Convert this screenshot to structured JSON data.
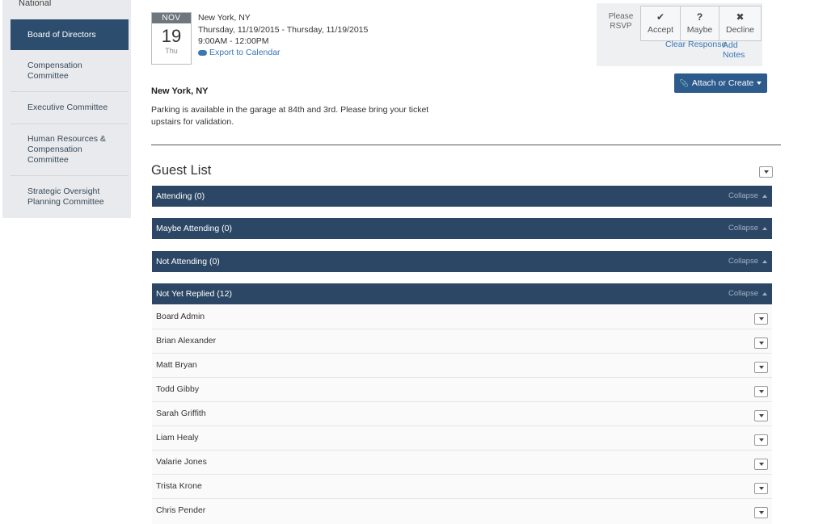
{
  "sidebar": {
    "top_label": "National",
    "items": [
      {
        "label": "Board of Directors",
        "active": true
      },
      {
        "label": "Compensation Committee",
        "active": false
      },
      {
        "label": "Executive Committee",
        "active": false
      },
      {
        "label": "Human Resources & Compensation Committee",
        "active": false
      },
      {
        "label": "Strategic Oversight Planning Committee",
        "active": false
      }
    ]
  },
  "event": {
    "month": "NOV",
    "day": "19",
    "weekday": "Thu",
    "location": "New York, NY",
    "date_range": "Thursday, 11/19/2015 - Thursday, 11/19/2015",
    "time_range": "9:00AM - 12:00PM",
    "export_label": "Export to Calendar",
    "location_title": "New York, NY",
    "location_description": "Parking is available in the garage at 84th and 3rd.  Please bring your ticket upstairs for validation."
  },
  "rsvp": {
    "label": "Please RSVP",
    "accept_label": "Accept",
    "maybe_label": "Maybe",
    "decline_label": "Decline",
    "accept_glyph": "✔",
    "maybe_glyph": "?",
    "decline_glyph": "✖",
    "clear_label": "Clear Response",
    "notes_label": "Add Notes"
  },
  "attach_button": "Attach or Create",
  "guest_list": {
    "title": "Guest List",
    "collapse_label": "Collapse",
    "groups": [
      {
        "label": "Attending (0)"
      },
      {
        "label": "Maybe Attending (0)"
      },
      {
        "label": "Not Attending (0)"
      },
      {
        "label": "Not Yet Replied (12)"
      }
    ],
    "guests": [
      "Board Admin",
      "Brian Alexander",
      "Matt Bryan",
      "Todd Gibby",
      "Sarah Griffith",
      "Liam Healy",
      "Valarie Jones",
      "Trista Krone",
      "Chris Pender"
    ]
  },
  "colors": {
    "nav_active": "#2d4d6e",
    "group_bar": "#2c4765",
    "link": "#3b77b3",
    "button_primary": "#2d5b8c"
  }
}
